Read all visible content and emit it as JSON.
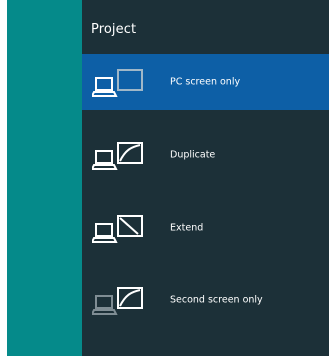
{
  "panel": {
    "title": "Project",
    "options": [
      {
        "label": "PC screen only",
        "icon": "pc-screen-only-icon",
        "selected": true
      },
      {
        "label": "Duplicate",
        "icon": "duplicate-icon",
        "selected": false
      },
      {
        "label": "Extend",
        "icon": "extend-icon",
        "selected": false
      },
      {
        "label": "Second screen only",
        "icon": "second-screen-only-icon",
        "selected": false
      }
    ]
  },
  "colors": {
    "desktop": "#058a8a",
    "panel_bg": "#1c3038",
    "selected_bg": "#0d5fa6"
  }
}
